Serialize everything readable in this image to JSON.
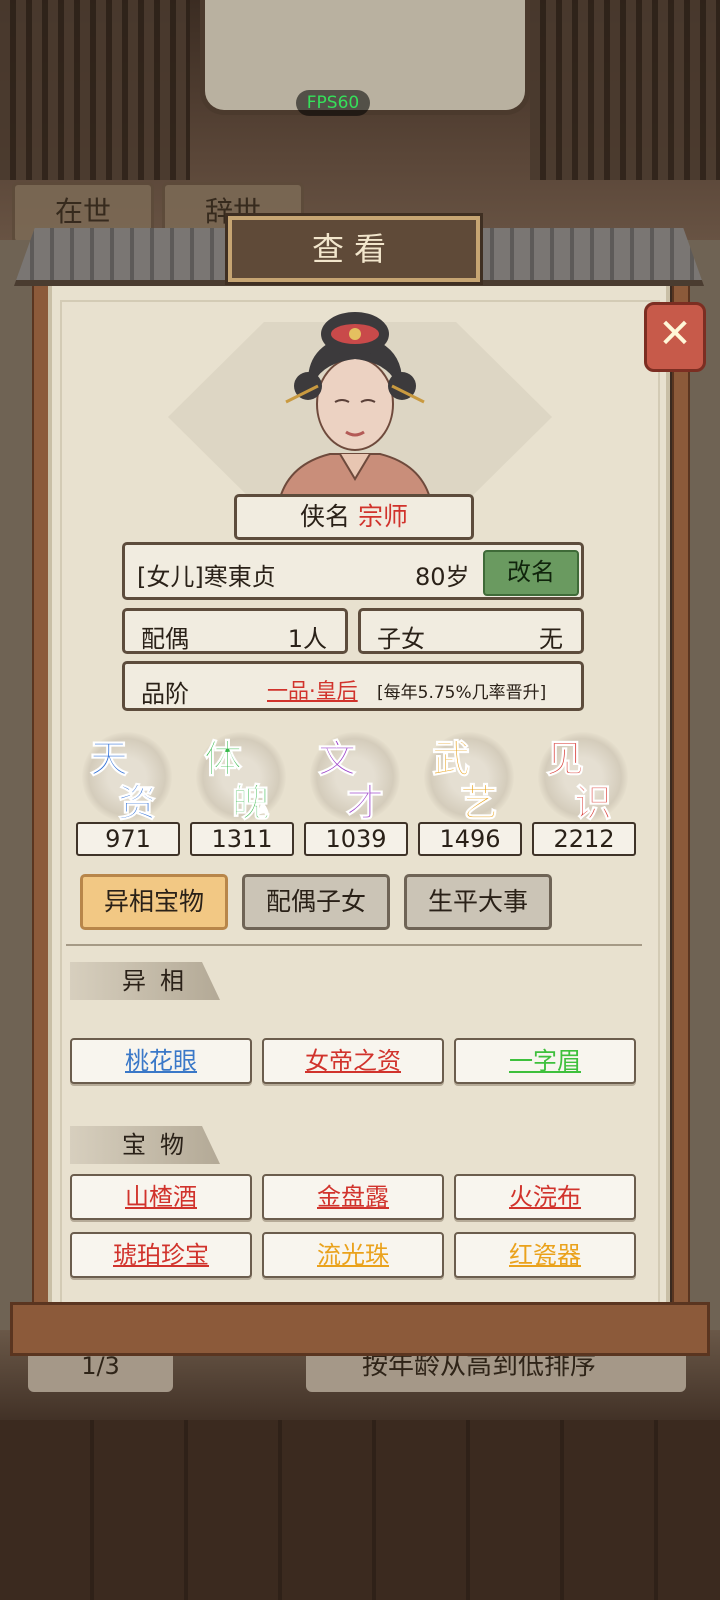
{
  "background": {
    "fps": "FPS60",
    "tabs": [
      "在世",
      "辞世"
    ],
    "pager": "1/3",
    "sort_label": "按年龄从高到低排序"
  },
  "dialog": {
    "title": "查看",
    "close_icon": "close-x-icon",
    "title_prefix": "侠名",
    "title_value": "宗师",
    "name": "[女儿]寒東贞",
    "age": "80岁",
    "rename_label": "改名",
    "spouse_label": "配偶",
    "spouse_value": "1人",
    "children_label": "子女",
    "children_value": "无",
    "rank_label": "品阶",
    "rank_value": "一品·皇后",
    "rank_note": "[每年5.75%几率晋升]",
    "attributes": [
      {
        "c1": "天",
        "c2": "资",
        "value": "971",
        "color": "#2f6fd6"
      },
      {
        "c1": "体",
        "c2": "魄",
        "value": "1311",
        "color": "#35b84a"
      },
      {
        "c1": "文",
        "c2": "才",
        "value": "1039",
        "color": "#9a3fc8"
      },
      {
        "c1": "武",
        "c2": "艺",
        "value": "1496",
        "color": "#e7a018"
      },
      {
        "c1": "见",
        "c2": "识",
        "value": "2212",
        "color": "#d9403a"
      }
    ],
    "tabs": [
      "异相宝物",
      "配偶子女",
      "生平大事"
    ],
    "section_traits": "异相",
    "traits": [
      {
        "label": "桃花眼",
        "color": "blue"
      },
      {
        "label": "女帝之资",
        "color": "red"
      },
      {
        "label": "一字眉",
        "color": "green"
      }
    ],
    "section_treasures": "宝物",
    "treasures": [
      {
        "label": "山楂酒",
        "color": "red"
      },
      {
        "label": "金盘露",
        "color": "red"
      },
      {
        "label": "火浣布",
        "color": "red"
      },
      {
        "label": "琥珀珍宝",
        "color": "red"
      },
      {
        "label": "流光珠",
        "color": "orange"
      },
      {
        "label": "红瓷器",
        "color": "orange"
      }
    ]
  }
}
